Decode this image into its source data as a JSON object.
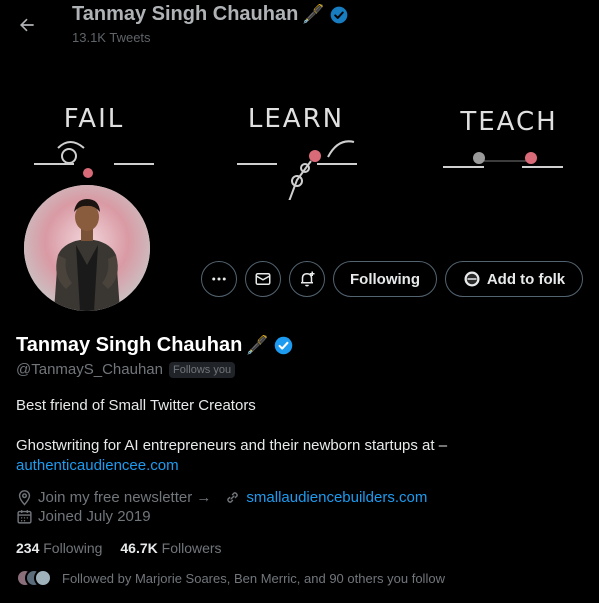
{
  "header": {
    "name": "Tanmay Singh Chauhan",
    "name_emoji": "🖋️",
    "tweet_count": "13.1K Tweets"
  },
  "banner": {
    "word_fail": "FAIL",
    "word_learn": "LEARN",
    "word_teach": "TEACH",
    "accent_color": "#d96a78"
  },
  "actions": {
    "more_icon": "more-icon",
    "message_icon": "mail-icon",
    "notify_icon": "bell-plus-icon",
    "following_label": "Following",
    "add_to_folk_label": "Add to folk"
  },
  "profile": {
    "name": "Tanmay Singh Chauhan",
    "name_emoji": "🖋️",
    "verified_color": "#1d9bf0",
    "handle": "@TanmayS_Chauhan",
    "follows_you": "Follows you",
    "bio_line1": "Best friend of Small Twitter Creators",
    "bio_line2": "Ghostwriting for AI entrepreneurs and their newborn startups at –",
    "bio_link": "authenticaudiencee.com",
    "location_text": "Join my free newsletter →",
    "website": "smallaudiencebuilders.com",
    "joined": "Joined July 2019"
  },
  "stats": {
    "following_count": "234",
    "following_label": "Following",
    "followers_count": "46.7K",
    "followers_label": "Followers"
  },
  "followed_by": {
    "text": "Followed by Marjorie Soares, Ben Merric, and 90 others you follow"
  }
}
